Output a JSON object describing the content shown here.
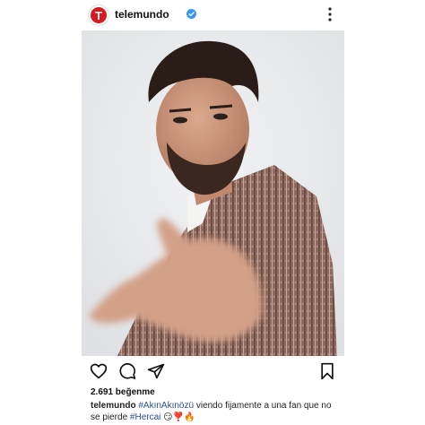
{
  "header": {
    "avatar_letter": "T",
    "username": "telemundo"
  },
  "post": {
    "likes": "2.691 beğenme",
    "caption": {
      "username": "telemundo",
      "hashtag1": "#AkınAkınözü",
      "text": " viendo fijamente a una fan que no se pierde ",
      "hashtag2": "#Hercai",
      "emoji": " 😏❣️🔥"
    }
  },
  "icons": [
    "verified-badge-icon",
    "more-options-icon",
    "heart-icon",
    "comment-icon",
    "share-icon",
    "bookmark-icon"
  ],
  "colors": {
    "brand": "#d71920",
    "verified": "#3897f0",
    "hashtag": "#2b4f8f"
  }
}
